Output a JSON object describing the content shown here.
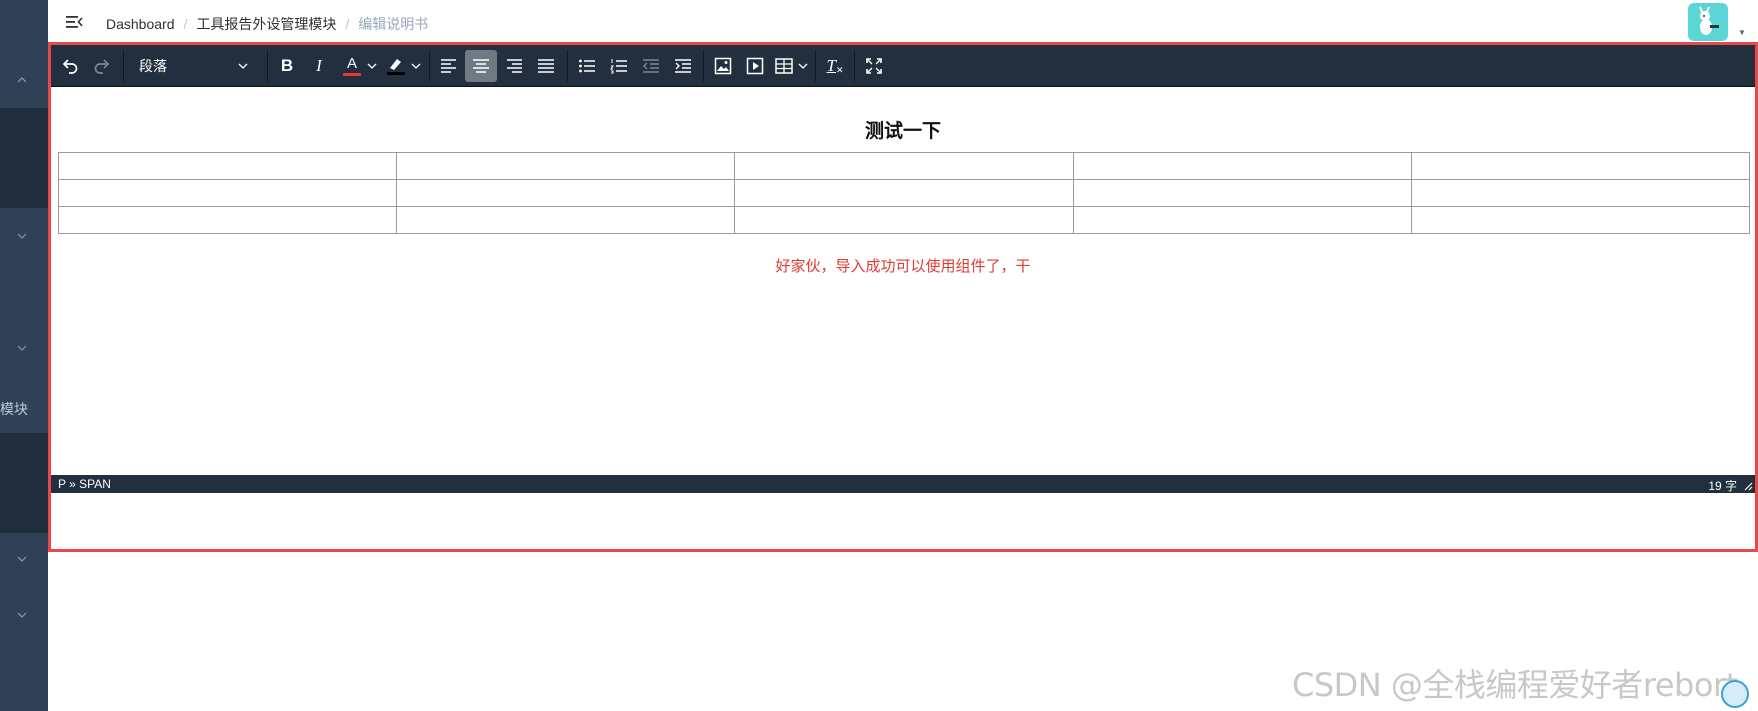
{
  "sidebar": {
    "visible_label": "模块",
    "icons": [
      "chevron-up-icon",
      "chevron-down-icon",
      "chevron-down-icon",
      "chevron-down-icon",
      "chevron-down-icon"
    ]
  },
  "navbar": {
    "breadcrumb": [
      "Dashboard",
      "工具报告外设管理模块",
      "编辑说明书"
    ]
  },
  "toolbar": {
    "block_format": "段落",
    "icons": [
      "undo-icon",
      "redo-icon",
      "bold-icon",
      "italic-icon",
      "text-color-icon",
      "highlight-icon",
      "align-left-icon",
      "align-center-icon",
      "align-right-icon",
      "align-justify-icon",
      "bullet-list-icon",
      "numbered-list-icon",
      "outdent-icon",
      "indent-icon",
      "image-icon",
      "media-icon",
      "table-icon",
      "clear-format-icon",
      "fullscreen-icon"
    ],
    "bold_label": "B",
    "italic_label": "I",
    "text_color_label": "A",
    "clear_format_label": "T"
  },
  "editor": {
    "title": "测试一下",
    "table": {
      "rows": 3,
      "cols": 5
    },
    "note": "好家伙，导入成功可以使用组件了，干"
  },
  "statusbar": {
    "path": "P » SPAN",
    "word_count": "19 字"
  },
  "colors": {
    "sidebar": "#304156",
    "toolbar": "#222f3e",
    "frame_border": "#e8484a",
    "note_text": "#e03b32",
    "avatar": "#5bd6d6"
  },
  "watermark": "CSDN @全栈编程爱好者rebort"
}
